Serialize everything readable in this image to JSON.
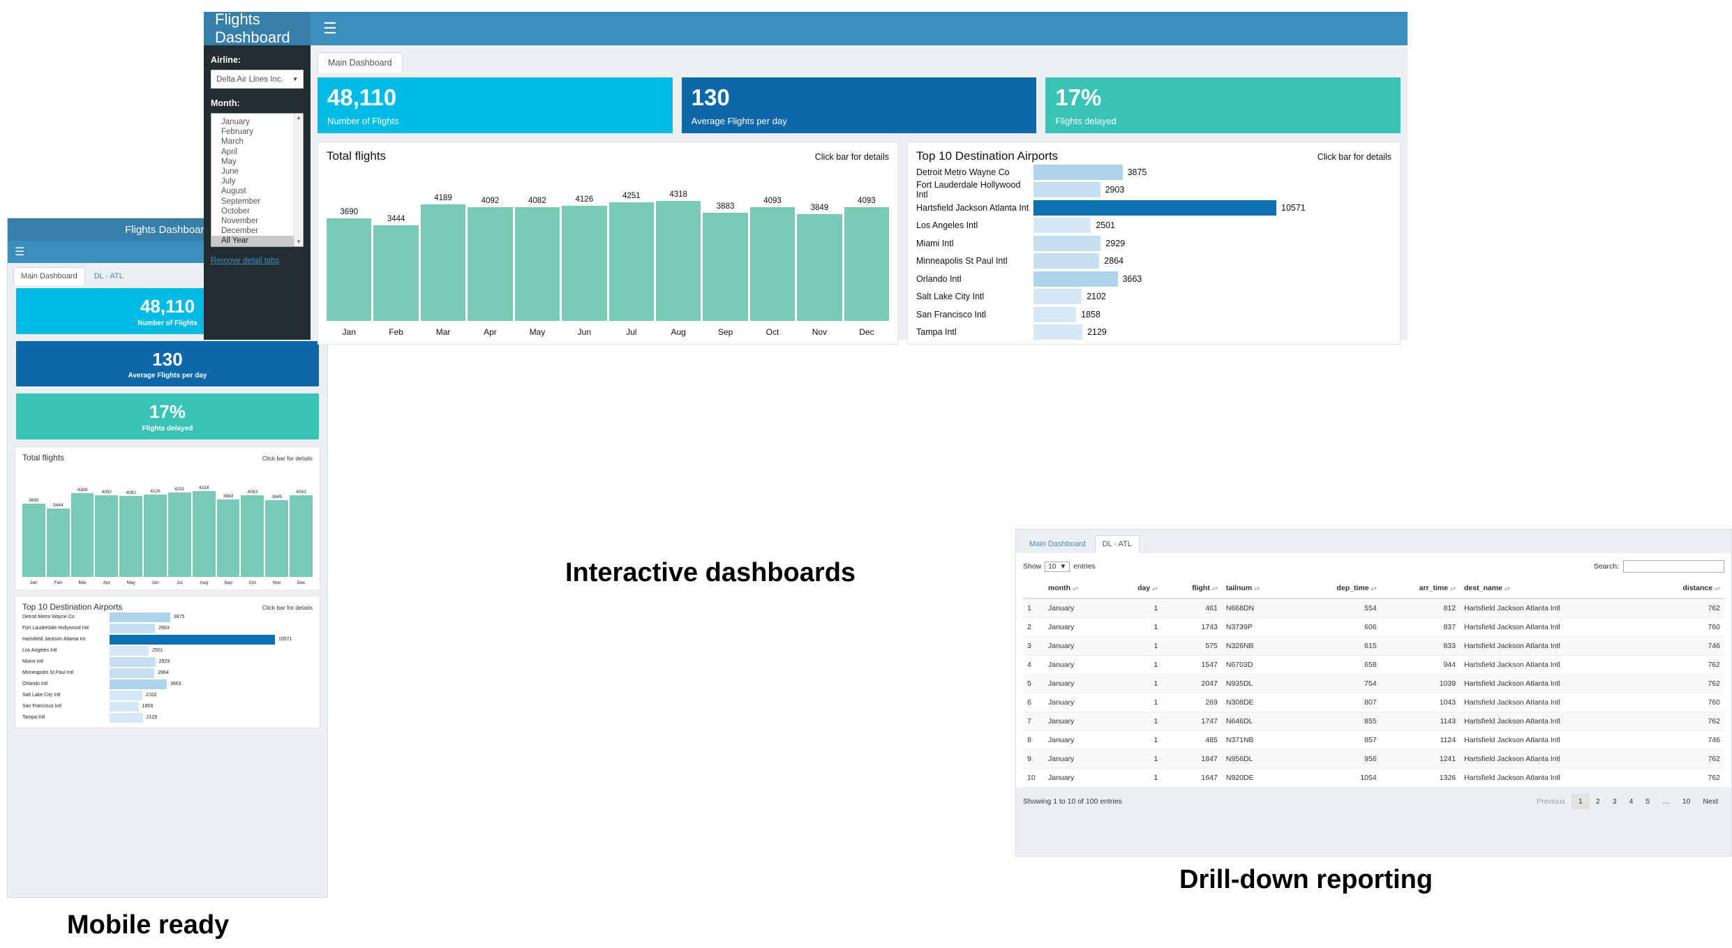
{
  "captions": {
    "mobile": "Mobile ready",
    "interactive": "Interactive dashboards",
    "drill": "Drill-down reporting"
  },
  "colors": {
    "brand_dark": "#367FA9",
    "navbar": "#3C8DBC",
    "sidebar": "#222D32",
    "kpi_cyan": "#00BCE4",
    "kpi_blue": "#0C68A8",
    "kpi_teal": "#37C3B5",
    "bar_green": "#79CBB8",
    "bar_light_blue": "#C6DFF0",
    "bar_dark_blue": "#0C71B0"
  },
  "app": {
    "brand_title": "Flights Dashboard",
    "menu_icon": "hamburger-menu-icon"
  },
  "sidebar": {
    "airline_label": "Airline:",
    "airline_value": "Delta Air Lines Inc.",
    "month_label": "Month:",
    "months": [
      "January",
      "February",
      "March",
      "April",
      "May",
      "June",
      "July",
      "August",
      "September",
      "October",
      "November",
      "December",
      "All Year"
    ],
    "month_selected": "All Year",
    "remove_tabs_link": "Remove detail tabs"
  },
  "tabs": {
    "main": "Main Dashboard",
    "detail": "DL - ATL"
  },
  "kpis": [
    {
      "value": "48,110",
      "label": "Number of Flights",
      "color": "#00BCE4"
    },
    {
      "value": "130",
      "label": "Average Flights per day",
      "color": "#0C68A8"
    },
    {
      "value": "17%",
      "label": "Flights delayed",
      "color": "#37C3B5"
    }
  ],
  "chart_data": [
    {
      "type": "bar",
      "title": "Total flights",
      "hint": "Click bar for details",
      "xlabel": "",
      "ylabel": "",
      "grid": false,
      "legend": "none",
      "orientation": "vertical",
      "categories": [
        "Jan",
        "Feb",
        "Mar",
        "Apr",
        "May",
        "Jun",
        "Jul",
        "Aug",
        "Sep",
        "Oct",
        "Nov",
        "Dec"
      ],
      "values": [
        3690,
        3444,
        4189,
        4092,
        4082,
        4126,
        4251,
        4318,
        3883,
        4093,
        3849,
        4093
      ],
      "ylim": [
        0,
        4318
      ]
    },
    {
      "type": "bar",
      "title": "Top 10 Destination Airports",
      "hint": "Click bar for details",
      "xlabel": "",
      "ylabel": "",
      "grid": false,
      "legend": "none",
      "orientation": "horizontal",
      "categories": [
        "Detroit Metro Wayne Co",
        "Fort Lauderdale Hollywood Intl",
        "Hartsfield Jackson Atlanta Int",
        "Los Angeles Intl",
        "Miami Intl",
        "Minneapolis St Paul Intl",
        "Orlando Intl",
        "Salt Lake City Intl",
        "San Francisco Intl",
        "Tampa Intl"
      ],
      "values": [
        3875,
        2903,
        10571,
        2501,
        2929,
        2864,
        3663,
        2102,
        1858,
        2129
      ],
      "xlim": [
        0,
        10571
      ]
    }
  ],
  "table": {
    "show_label": "Show",
    "show_value": "10",
    "entries_label": "entries",
    "search_label": "Search:",
    "search_value": "",
    "search_placeholder": "",
    "columns": [
      "",
      "month",
      "day",
      "flight",
      "tailnum",
      "dep_time",
      "arr_time",
      "dest_name",
      "distance"
    ],
    "rows": [
      [
        "1",
        "January",
        "1",
        "461",
        "N668DN",
        "554",
        "812",
        "Hartsfield Jackson Atlanta Intl",
        "762"
      ],
      [
        "2",
        "January",
        "1",
        "1743",
        "N3739P",
        "606",
        "837",
        "Hartsfield Jackson Atlanta Intl",
        "760"
      ],
      [
        "3",
        "January",
        "1",
        "575",
        "N326NB",
        "615",
        "833",
        "Hartsfield Jackson Atlanta Intl",
        "746"
      ],
      [
        "4",
        "January",
        "1",
        "1547",
        "N6703D",
        "658",
        "944",
        "Hartsfield Jackson Atlanta Intl",
        "762"
      ],
      [
        "5",
        "January",
        "1",
        "2047",
        "N935DL",
        "754",
        "1039",
        "Hartsfield Jackson Atlanta Intl",
        "762"
      ],
      [
        "6",
        "January",
        "1",
        "269",
        "N308DE",
        "807",
        "1043",
        "Hartsfield Jackson Atlanta Intl",
        "760"
      ],
      [
        "7",
        "January",
        "1",
        "1747",
        "N646DL",
        "855",
        "1143",
        "Hartsfield Jackson Atlanta Intl",
        "762"
      ],
      [
        "8",
        "January",
        "1",
        "485",
        "N371NB",
        "857",
        "1124",
        "Hartsfield Jackson Atlanta Intl",
        "746"
      ],
      [
        "9",
        "January",
        "1",
        "1847",
        "N956DL",
        "956",
        "1241",
        "Hartsfield Jackson Atlanta Intl",
        "762"
      ],
      [
        "10",
        "January",
        "1",
        "1647",
        "N920DE",
        "1054",
        "1326",
        "Hartsfield Jackson Atlanta Intl",
        "762"
      ]
    ],
    "info": "Showing 1 to 10 of 100 entries",
    "pagination": {
      "previous": "Previous",
      "pages": [
        "1",
        "2",
        "3",
        "4",
        "5",
        "…",
        "10"
      ],
      "current": "1",
      "next": "Next"
    }
  }
}
